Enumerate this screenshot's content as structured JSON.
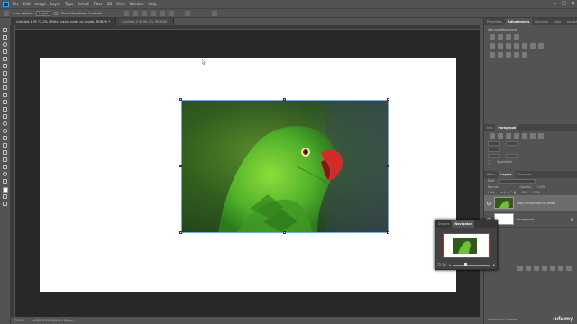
{
  "menubar": {
    "logo": "Ps",
    "items": [
      "File",
      "Edit",
      "Image",
      "Layer",
      "Type",
      "Select",
      "Filter",
      "3D",
      "View",
      "Window",
      "Help"
    ]
  },
  "options": {
    "auto_select_label": "Auto-Select:",
    "auto_select_value": "Layer",
    "transform_label": "Show Transform Controls"
  },
  "tabs": [
    {
      "label": "Untitled-1 @ 72.2% (Milky taking birds on photo, RGB/8) *"
    },
    {
      "label": "Untitled-2 @ 66.7% (RGB/8)"
    }
  ],
  "statusbar": {
    "zoom": "72.2%",
    "doc_info": "sRGB IEC61966-2.1 (8bpc)"
  },
  "right_panel": {
    "tabs_top": [
      "Properties",
      "Adjustments",
      "Libraries",
      "Color",
      "Swatches"
    ],
    "adjust_title": "Add an adjustment",
    "tabs_para": [
      "Info",
      "Paragraph"
    ],
    "hyphenate": "Hyphenate",
    "tabs_layers": [
      "Paths",
      "Layers",
      "Channels"
    ],
    "kind_label": "Kind",
    "blend_mode": "Normal",
    "opacity_label": "Opacity:",
    "opacity_value": "100%",
    "lock_label": "Lock:",
    "fill_label": "Fill:",
    "fill_value": "100%",
    "layers": [
      {
        "name": "Milky taking birds on photo",
        "selected": true
      },
      {
        "name": "Background",
        "selected": false
      }
    ],
    "bottom_label": "Adobe Color Themes"
  },
  "navigator": {
    "tabs": [
      "Shapes",
      "Navigator"
    ],
    "zoom": "72.2%"
  },
  "watermark": "udemy"
}
